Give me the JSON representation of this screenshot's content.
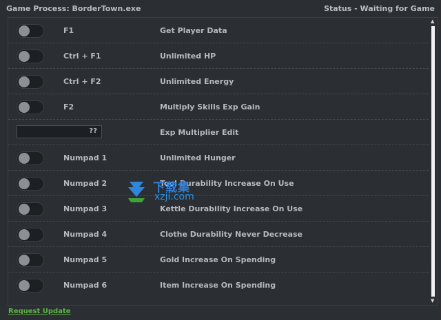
{
  "header": {
    "process": "Game Process: BorderTown.exe",
    "status": "Status - Waiting for Game"
  },
  "rows": [
    {
      "type": "toggle",
      "key": "F1",
      "label": "Get Player Data"
    },
    {
      "type": "toggle",
      "key": "Ctrl + F1",
      "label": "Unlimited HP"
    },
    {
      "type": "toggle",
      "key": "Ctrl + F2",
      "label": "Unlimited Energy"
    },
    {
      "type": "toggle",
      "key": "F2",
      "label": "Multiply Skills Exp Gain"
    },
    {
      "type": "edit",
      "value": "??",
      "label": "Exp Multiplier Edit"
    },
    {
      "type": "toggle",
      "key": "Numpad 1",
      "label": "Unlimited Hunger"
    },
    {
      "type": "toggle",
      "key": "Numpad 2",
      "label": "Tool Durability Increase On Use"
    },
    {
      "type": "toggle",
      "key": "Numpad 3",
      "label": "Kettle Durability Increase On Use"
    },
    {
      "type": "toggle",
      "key": "Numpad 4",
      "label": "Clothe Durability Never Decrease"
    },
    {
      "type": "toggle",
      "key": "Numpad 5",
      "label": "Gold Increase On Spending"
    },
    {
      "type": "toggle",
      "key": "Numpad 6",
      "label": "Item Increase On Spending"
    }
  ],
  "footer": {
    "link": "Request Update"
  },
  "watermark": {
    "cn": "下载集",
    "en": "xzji.com"
  },
  "colors": {
    "background": "#2b2f33",
    "link": "#5fb546",
    "watermark": "#2f7fd8"
  }
}
